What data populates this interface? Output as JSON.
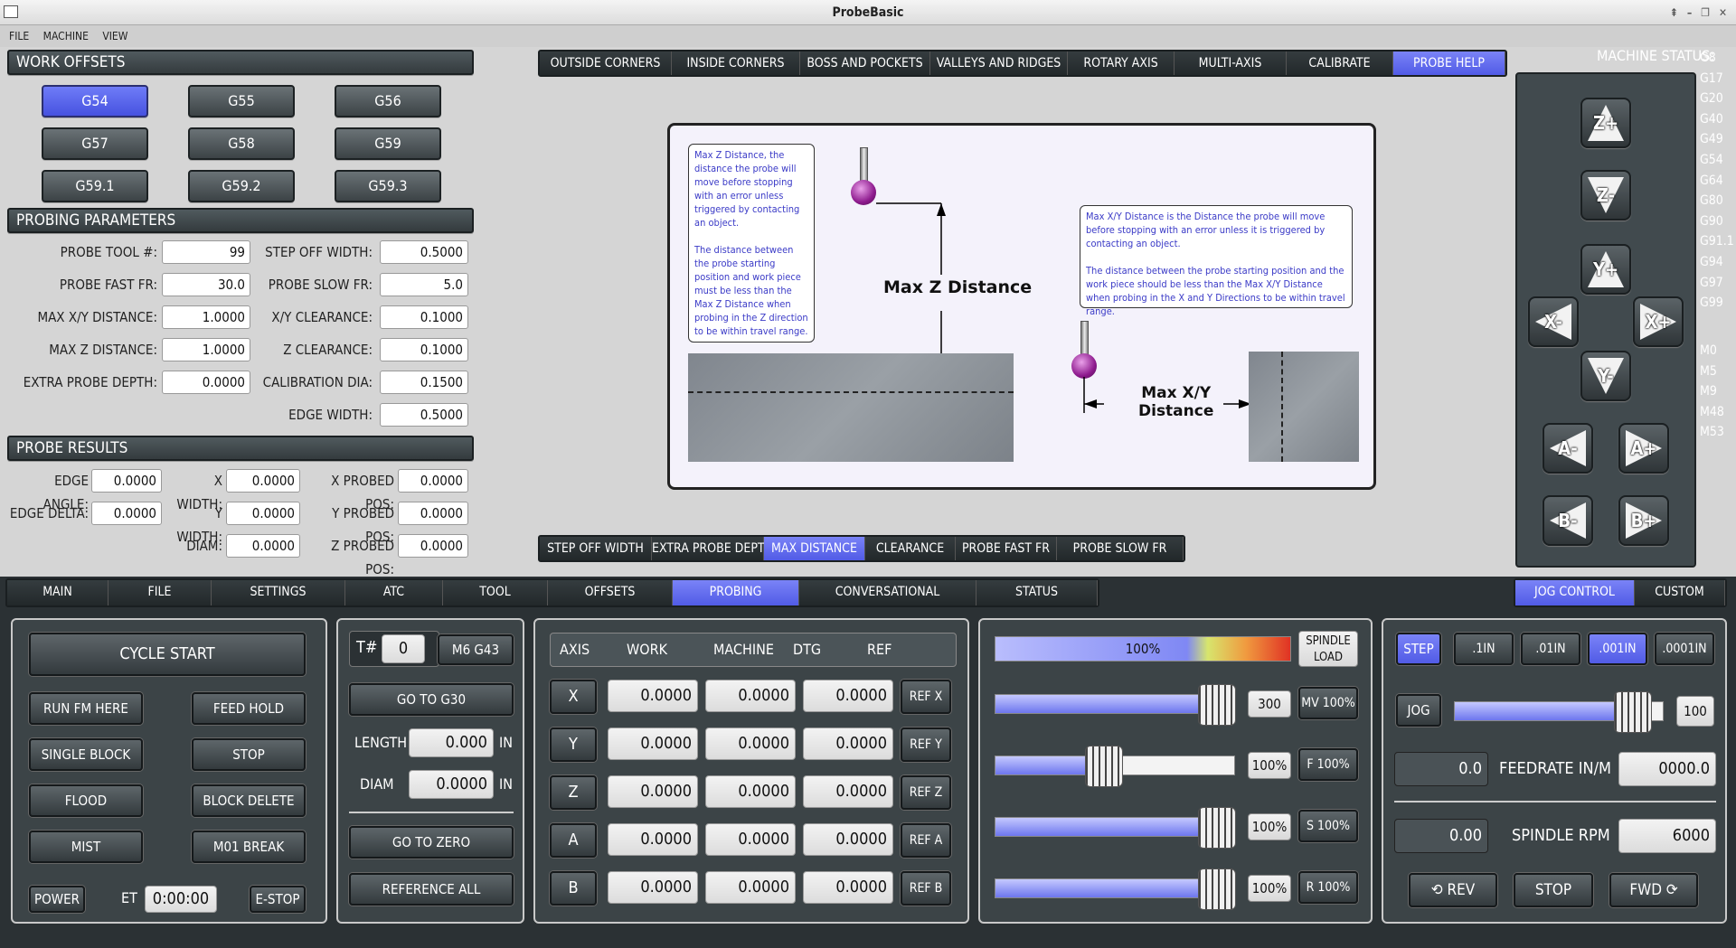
{
  "window": {
    "title": "ProbeBasic"
  },
  "menu": [
    "FILE",
    "MACHINE",
    "VIEW"
  ],
  "work_offsets": {
    "title": "WORK OFFSETS",
    "buttons": [
      "G54",
      "G55",
      "G56",
      "G57",
      "G58",
      "G59",
      "G59.1",
      "G59.2",
      "G59.3"
    ],
    "active": "G54"
  },
  "probing_params": {
    "title": "PROBING PARAMETERS",
    "rows": [
      {
        "l1": "PROBE TOOL #:",
        "v1": "99",
        "l2": "STEP OFF WIDTH:",
        "v2": "0.5000"
      },
      {
        "l1": "PROBE FAST FR:",
        "v1": "30.0",
        "l2": "PROBE SLOW FR:",
        "v2": "5.0"
      },
      {
        "l1": "MAX X/Y DISTANCE:",
        "v1": "1.0000",
        "l2": "X/Y CLEARANCE:",
        "v2": "0.1000"
      },
      {
        "l1": "MAX Z DISTANCE:",
        "v1": "1.0000",
        "l2": "Z CLEARANCE:",
        "v2": "0.1000"
      },
      {
        "l1": "EXTRA PROBE DEPTH:",
        "v1": "0.0000",
        "l2": "CALIBRATION DIA:",
        "v2": "0.1500"
      },
      {
        "l1": "",
        "v1": "",
        "l2": "EDGE WIDTH:",
        "v2": "0.5000"
      }
    ]
  },
  "probe_results": {
    "title": "PROBE RESULTS",
    "rows": [
      {
        "l1": "EDGE ANGLE:",
        "v1": "0.0000",
        "l2": "X WIDTH:",
        "v2": "0.0000",
        "l3": "X PROBED POS:",
        "v3": "0.0000"
      },
      {
        "l1": "EDGE DELTA:",
        "v1": "0.0000",
        "l2": "Y WIDTH:",
        "v2": "0.0000",
        "l3": "Y PROBED POS:",
        "v3": "0.0000"
      },
      {
        "l1": "",
        "v1": "",
        "l2": "DIAM:",
        "v2": "0.0000",
        "l3": "Z PROBED POS:",
        "v3": "0.0000"
      }
    ]
  },
  "probe_tabs": {
    "items": [
      "OUTSIDE CORNERS",
      "INSIDE CORNERS",
      "BOSS AND POCKETS",
      "VALLEYS AND RIDGES",
      "ROTARY AXIS",
      "MULTI-AXIS",
      "CALIBRATE",
      "PROBE HELP"
    ],
    "active": "PROBE HELP"
  },
  "help_diagram": {
    "note_z": "Max Z Distance, the distance the probe will move before stopping with an error unless triggered by contacting an object.\n\nThe distance between the probe starting position and work piece must be less than the Max Z Distance when probing in the Z direction to be within travel range.",
    "note_xy": "Max X/Y Distance is the Distance the probe will move before stopping with an error unless it is triggered by contacting an object.\n\nThe distance between the probe starting position and the work piece should be less than the Max X/Y Distance when probing in the X and Y Directions to be within travel range.",
    "label_z": "Max Z Distance",
    "label_xy": "Max X/Y\nDistance"
  },
  "help_tabs": {
    "items": [
      "STEP OFF WIDTH",
      "EXTRA PROBE DEPTH",
      "MAX DISTANCE",
      "CLEARANCE",
      "PROBE FAST FR",
      "PROBE SLOW FR"
    ],
    "active": "MAX DISTANCE"
  },
  "machine_status": {
    "title": "MACHINE STATUS:",
    "codes": [
      "G8",
      "G17",
      "G20",
      "G40",
      "G49",
      "G54",
      "G64",
      "G80",
      "G90",
      "G91.1",
      "G94",
      "G97",
      "G99",
      "M0",
      "M5",
      "M9",
      "M48",
      "M53"
    ]
  },
  "jog_buttons": [
    "Z+",
    "Z-",
    "Y+",
    "X-",
    "X+",
    "Y-",
    "A-",
    "A+",
    "B-",
    "B+"
  ],
  "main_tabs": {
    "items": [
      "MAIN",
      "FILE",
      "SETTINGS",
      "ATC",
      "TOOL",
      "OFFSETS",
      "PROBING",
      "CONVERSATIONAL",
      "STATUS"
    ],
    "active": "PROBING"
  },
  "right_tabs": {
    "items": [
      "JOG CONTROL",
      "CUSTOM"
    ],
    "active": "JOG CONTROL"
  },
  "program_ctrl": {
    "cycle_start": "CYCLE START",
    "run_from_here": "RUN FM HERE",
    "feed_hold": "FEED HOLD",
    "single_block": "SINGLE BLOCK",
    "stop": "STOP",
    "flood": "FLOOD",
    "block_delete": "BLOCK DELETE",
    "mist": "MIST",
    "m01_break": "M01 BREAK",
    "power": "POWER",
    "et_label": "ET",
    "et_value": "0:00:00",
    "estop": "E-STOP"
  },
  "tool_ctrl": {
    "t_label": "T#",
    "t_value": "0",
    "m6": "M6 G43",
    "go_g30": "GO TO G30",
    "length_label": "LENGTH",
    "length_value": "0.000",
    "length_unit": "IN",
    "diam_label": "DIAM",
    "diam_value": "0.0000",
    "diam_unit": "IN",
    "go_zero": "GO TO ZERO",
    "ref_all": "REFERENCE ALL"
  },
  "dro": {
    "headers": [
      "AXIS",
      "WORK",
      "MACHINE",
      "DTG",
      "REF"
    ],
    "rows": [
      {
        "axis": "X",
        "work": "0.0000",
        "machine": "0.0000",
        "dtg": "0.0000",
        "ref": "REF X"
      },
      {
        "axis": "Y",
        "work": "0.0000",
        "machine": "0.0000",
        "dtg": "0.0000",
        "ref": "REF Y"
      },
      {
        "axis": "Z",
        "work": "0.0000",
        "machine": "0.0000",
        "dtg": "0.0000",
        "ref": "REF Z"
      },
      {
        "axis": "A",
        "work": "0.0000",
        "machine": "0.0000",
        "dtg": "0.0000",
        "ref": "REF A"
      },
      {
        "axis": "B",
        "work": "0.0000",
        "machine": "0.0000",
        "dtg": "0.0000",
        "ref": "REF B"
      }
    ]
  },
  "overrides": {
    "spindle_load": {
      "value": "100%",
      "label": "SPINDLE\nLOAD",
      "level": 1.0
    },
    "rows": [
      {
        "value": "300",
        "button": "MV 100%",
        "level": 0.92
      },
      {
        "value": "100%",
        "button": "F 100%",
        "level": 0.45
      },
      {
        "value": "100%",
        "button": "S 100%",
        "level": 0.92
      },
      {
        "value": "100%",
        "button": "R 100%",
        "level": 0.92
      }
    ]
  },
  "jog_ctrl": {
    "step": "STEP",
    "increments": [
      ".1IN",
      ".01IN",
      ".001IN",
      ".0001IN"
    ],
    "active_inc": ".001IN",
    "jog": "JOG",
    "jog_value": "100",
    "jog_level": 0.85,
    "feed_value": "0.0",
    "feed_label": "FEEDRATE IN/M",
    "feed_set": "0000.0",
    "rpm_value": "0.00",
    "rpm_label": "SPINDLE RPM",
    "rpm_set": "6000",
    "rev": "⟲ REV",
    "stop": "STOP",
    "fwd": "FWD ⟳"
  }
}
